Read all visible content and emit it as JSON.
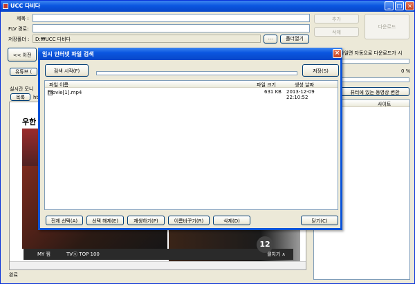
{
  "window": {
    "title": "UCC 다비다"
  },
  "form": {
    "title_label": "제목 :",
    "flv_label": "FLV 경로:",
    "save_label": "저장폴더 :",
    "save_path": "D:₩UCC 다비다",
    "browse_label": "...",
    "open_folder_label": "폴더열기",
    "add_label": "추가",
    "delete_label": "삭제",
    "download_label": "다운로드"
  },
  "nav": {
    "back_label": "<< 이전"
  },
  "left": {
    "tab_youtube": "유튜브 (",
    "live_monitor": "실시간 모니",
    "list_tab": "목록",
    "list_tab2": "htt",
    "page_text": "우한",
    "video_items": [
      "MY 찜",
      "TVⓔ TOP 100"
    ],
    "video_badge": "12",
    "expand_label": "펼치기 ∧"
  },
  "right": {
    "auto_text": "파일면 자동으로 다운로드가 시",
    "percent": "0 %",
    "convert_label": "퓨터에 있는 동영상 변환",
    "col_site": "사이트"
  },
  "status": {
    "text": "완료"
  },
  "dialog": {
    "title": "임시 인터넷 파일 검색",
    "search_label": "검색 시작(F)",
    "save_label": "저장(S)",
    "columns": [
      "파일 이름",
      "파일 크기",
      "생성 날짜"
    ],
    "rows": [
      {
        "name": "movie[1].mp4",
        "size": "631 KB",
        "date": "2013-12-09 22:10:52"
      }
    ],
    "btn_select_all": "전체 선택(A)",
    "btn_deselect": "선택 해제(E)",
    "btn_play": "재생하기(P)",
    "btn_rename": "이름바꾸기(R)",
    "btn_delete": "삭제(D)",
    "btn_close": "닫기(C)"
  }
}
